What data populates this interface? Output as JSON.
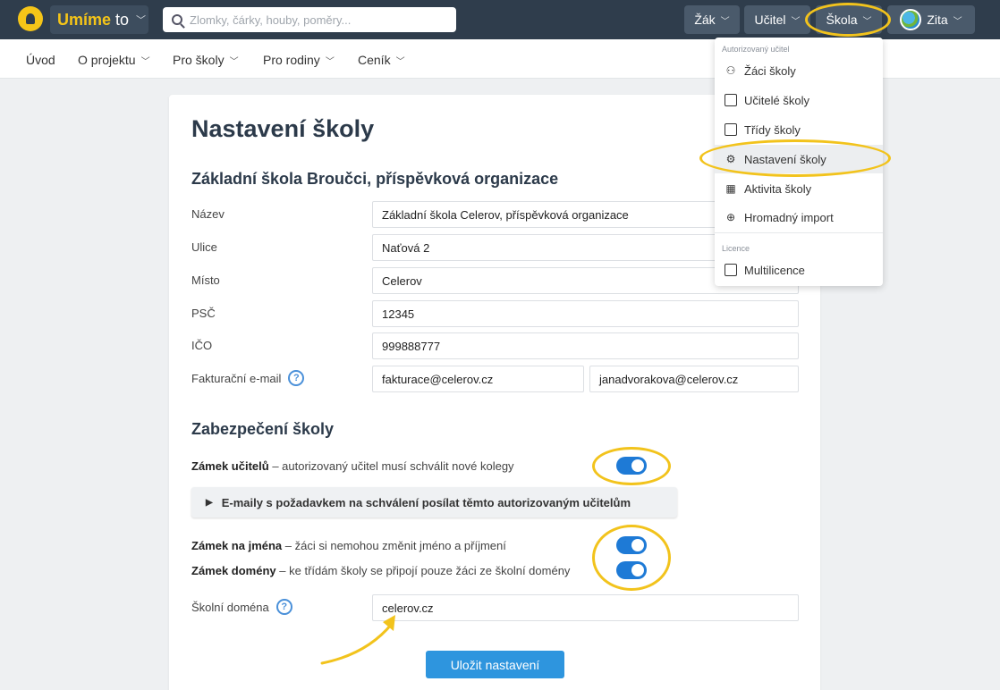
{
  "brand": {
    "part1": "Umíme",
    "part2": "to"
  },
  "search": {
    "placeholder": "Zlomky, čárky, houby, poměry..."
  },
  "topnav": {
    "zak": "Žák",
    "ucitel": "Učitel",
    "skola": "Škola",
    "user": "Zita"
  },
  "subnav": {
    "uvod": "Úvod",
    "projekt": "O projektu",
    "skoly": "Pro školy",
    "rodiny": "Pro rodiny",
    "cenik": "Ceník"
  },
  "page": {
    "title": "Nastavení školy",
    "school_name": "Základní škola Broučci, příspěvková organizace",
    "security_title": "Zabezpečení školy",
    "save_label": "Uložit nastavení"
  },
  "form": {
    "nazev_label": "Název",
    "nazev": "Základní škola Celerov, příspěvková organizace",
    "ulice_label": "Ulice",
    "ulice": "Naťová 2",
    "misto_label": "Místo",
    "misto": "Celerov",
    "psc_label": "PSČ",
    "psc": "12345",
    "ico_label": "IČO",
    "ico": "999888777",
    "email_label": "Fakturační e-mail",
    "email1": "fakturace@celerov.cz",
    "email2": "janadvorakova@celerov.cz",
    "domena_label": "Školní doména",
    "domena": "celerov.cz"
  },
  "security": {
    "teacher_lock_bold": "Zámek učitelů",
    "teacher_lock_text": " – autorizovaný učitel musí schválit nové kolegy",
    "emails_details": "E-maily s požadavkem na schválení posílat těmto autorizovaným učitelům",
    "name_lock_bold": "Zámek na jména",
    "name_lock_text": " – žáci si nemohou změnit jméno a příjmení",
    "domain_lock_bold": "Zámek domény",
    "domain_lock_text": " – ke třídám školy se připojí pouze žáci ze školní domény",
    "teacher_lock_on": true,
    "name_lock_on": true,
    "domain_lock_on": true
  },
  "dropdown": {
    "section1": "Autorizovaný učitel",
    "zaci": "Žáci školy",
    "ucitele": "Učitelé školy",
    "tridy": "Třídy školy",
    "nastaveni": "Nastavení školy",
    "aktivita": "Aktivita školy",
    "import": "Hromadný import",
    "section2": "Licence",
    "multilicence": "Multilicence"
  },
  "colors": {
    "accent": "#2e95de",
    "toggle": "#1e7ad6",
    "highlight": "#f2c31c",
    "topbar": "#2f3d4c"
  }
}
